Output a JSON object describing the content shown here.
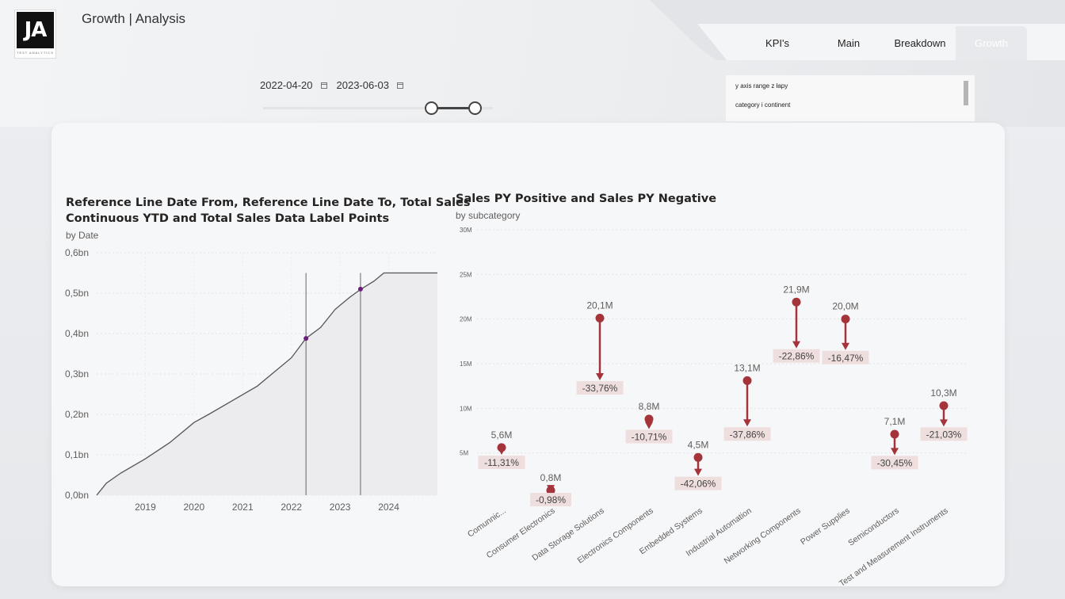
{
  "header": {
    "logo_text": "JA",
    "logo_sub": "TEST ANALYTICS",
    "page_title": "Growth | Analysis"
  },
  "tabs": [
    {
      "label": "KPI's",
      "active": false
    },
    {
      "label": "Main",
      "active": false
    },
    {
      "label": "Breakdown",
      "active": false
    },
    {
      "label": "Growth",
      "active": true
    }
  ],
  "date_filter": {
    "start": "2022-04-20",
    "end": "2023-06-03",
    "slider_start_pct": 73,
    "slider_end_pct": 92
  },
  "filter_list": {
    "items": [
      "y axis range z łapy",
      "category i continent"
    ]
  },
  "colors": {
    "accent": "#a4343a",
    "line": "#555555",
    "marker": "#6b1f7c",
    "label_bg": "#efdede"
  },
  "chart_data": [
    {
      "type": "area",
      "title_line1": "Reference Line Date From, Reference Line Date To, Total Sales",
      "title_line2": "Continuous YTD and Total Sales Data Label Points",
      "subtitle": "by Date",
      "y_ticks": [
        "0,6bn",
        "0,5bn",
        "0,4bn",
        "0,3bn",
        "0,2bn",
        "0,1bn",
        "0,0bn"
      ],
      "x_ticks": [
        "2019",
        "2020",
        "2021",
        "2022",
        "2023",
        "2024"
      ],
      "ylim": [
        0,
        0.6
      ],
      "xlim": [
        2018.0,
        2025.0
      ],
      "series": [
        {
          "x": [
            2018.0,
            2018.2,
            2018.5,
            2019.0,
            2019.5,
            2020.0,
            2020.3,
            2020.8,
            2021.3,
            2021.6,
            2022.0,
            2022.3,
            2022.6,
            2022.9,
            2023.2,
            2023.43,
            2023.7,
            2023.9,
            2025.0
          ],
          "y": [
            0.0,
            0.03,
            0.055,
            0.09,
            0.13,
            0.18,
            0.2,
            0.235,
            0.27,
            0.3,
            0.34,
            0.388,
            0.415,
            0.46,
            0.49,
            0.51,
            0.53,
            0.55,
            0.55
          ]
        }
      ],
      "reference_lines": [
        {
          "x": 2022.3,
          "y": 0.388
        },
        {
          "x": 2023.42,
          "y": 0.51
        }
      ]
    },
    {
      "type": "scatter",
      "title": "Sales PY Positive and Sales PY Negative",
      "subtitle": "by subcategory",
      "y_ticks": [
        "30M",
        "25M",
        "20M",
        "15M",
        "10M",
        "5M"
      ],
      "ylim": [
        0,
        30
      ],
      "categories": [
        "Comunnic...",
        "Consumer Electronics",
        "Data Storage Solutions",
        "Electronics Components",
        "Embedded Systems",
        "Industrial Automation",
        "Networking Components",
        "Power Supplies",
        "Semiconductors",
        "Test and Measurement Instruments"
      ],
      "values": [
        5.6,
        0.8,
        20.1,
        8.8,
        4.5,
        13.1,
        21.9,
        20.0,
        7.1,
        10.3
      ],
      "value_labels": [
        "5,6M",
        "0,8M",
        "20,1M",
        "8,8M",
        "4,5M",
        "13,1M",
        "21,9M",
        "20,0M",
        "7,1M",
        "10,3M"
      ],
      "change_pct": [
        -11.31,
        -0.98,
        -33.76,
        -10.71,
        -42.06,
        -37.86,
        -22.86,
        -16.47,
        -30.45,
        -21.03
      ],
      "change_labels": [
        "-11,31%",
        "-0,98%",
        "-33,76%",
        "-10,71%",
        "-42,06%",
        "-37,86%",
        "-22,86%",
        "-16,47%",
        "-30,45%",
        "-21,03%"
      ]
    }
  ]
}
